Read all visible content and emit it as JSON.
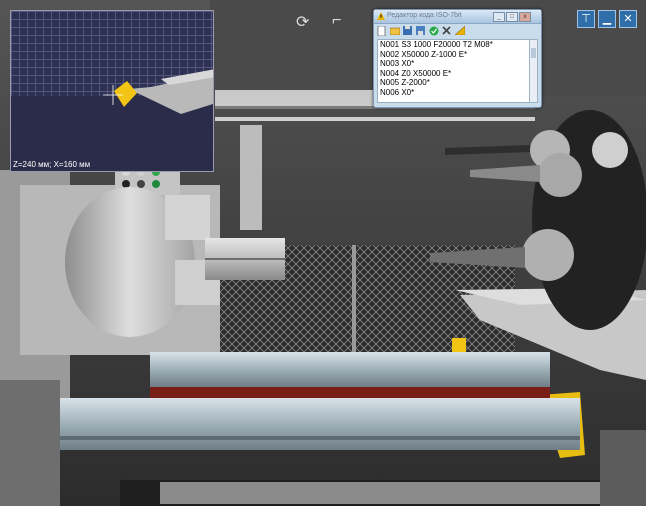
{
  "preview": {
    "coords": "Z=240 мм; X=160 мм"
  },
  "editor": {
    "title": "Редактор кода ISO-7bit",
    "lines": [
      "N001 S3 1000 F20000 T2 M08*",
      "N002 X50000 Z-1000 E*",
      "N003 X0*",
      "N004 Z0 X50000 E*",
      "N005 Z-2000*",
      "N006 X0*"
    ],
    "toolbar_icons": [
      "new-doc-icon",
      "open-folder-icon",
      "save-icon",
      "save-as-icon",
      "check-icon",
      "delete-icon",
      "ruler-icon"
    ]
  },
  "controls": {
    "minimize": "▁",
    "restore": "⊤",
    "close": "✕"
  },
  "top_icons": {
    "rotate": "⟳",
    "coolant": "⌐"
  },
  "colors": {
    "preview_bg": "#2b2c4a",
    "grid": "#54587c",
    "editor_bg": "#c8dcec",
    "tool_insert": "#f2c414",
    "control_button": "#2f6ea8",
    "chip_tray": "#7a1e18"
  }
}
